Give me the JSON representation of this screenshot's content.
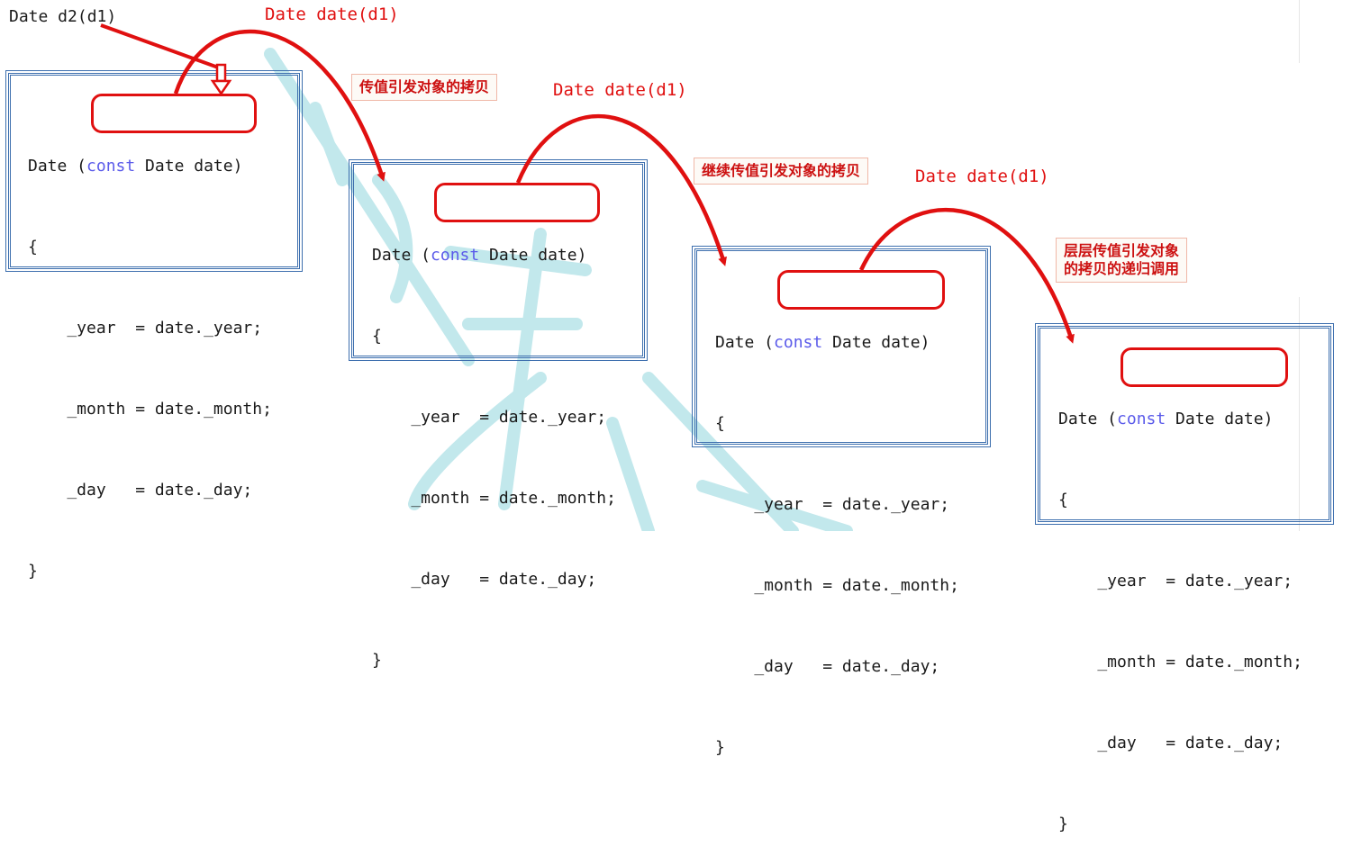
{
  "caller": "Date d2(d1)",
  "param_labels": [
    "Date date(d1)",
    "Date date(d1)",
    "Date date(d1)"
  ],
  "notes": [
    "传值引发对象的拷贝",
    "继续传值引发对象的拷贝",
    "层层传值引发对象\n的拷贝的递归调用"
  ],
  "code": {
    "sig_prefix": "Date (",
    "keyword": "const",
    "sig_param": " Date date",
    "sig_suffix": ")",
    "open_brace": "{",
    "line_year": "    _year  = date._year;",
    "line_month": "    _month = date._month;",
    "line_day": "    _day   = date._day;",
    "close_brace": "}"
  },
  "colors": {
    "arrow": "#e01010",
    "box_border": "#3d6fae",
    "keyword": "#5b5bea",
    "watermark": "#bfe6ea"
  }
}
